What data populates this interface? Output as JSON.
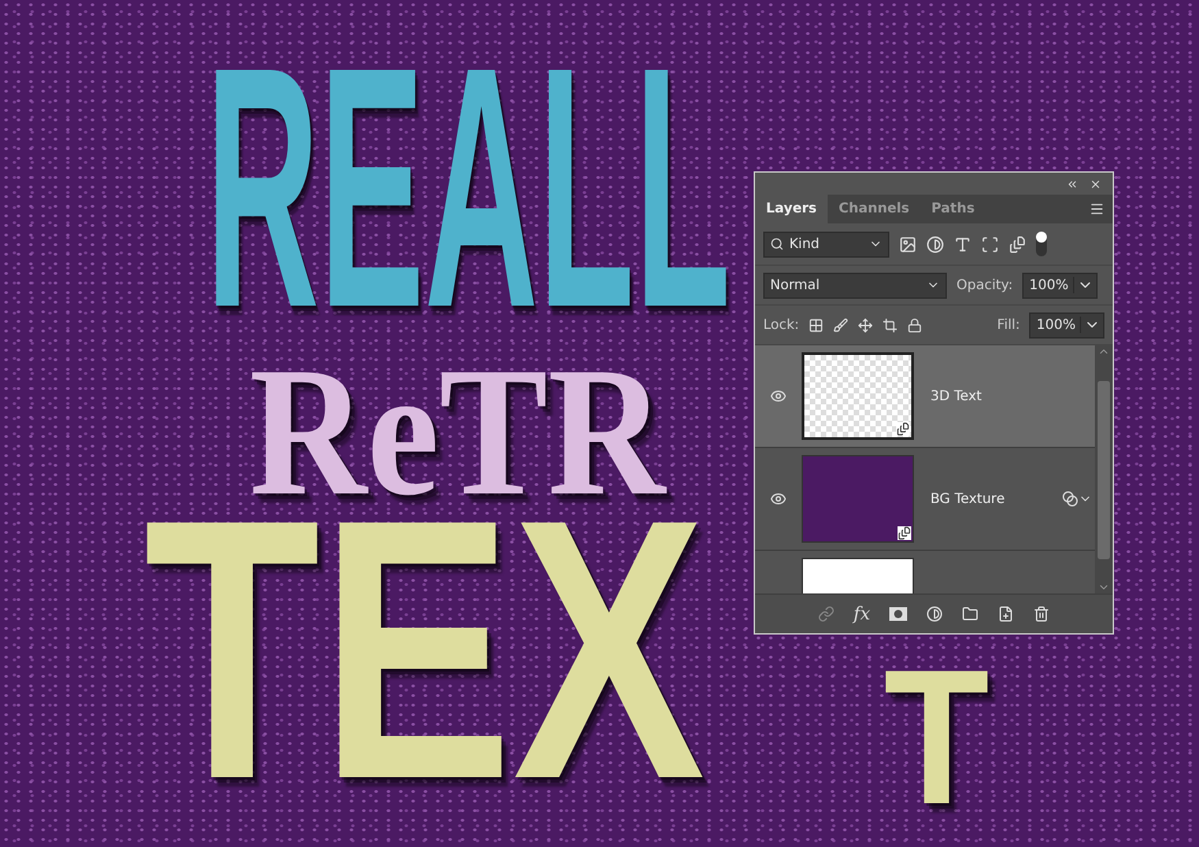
{
  "canvas": {
    "words": [
      {
        "text": "REALL",
        "kind": "sans",
        "color": "#4fb2cc"
      },
      {
        "text": "ReTR",
        "kind": "serif",
        "color": "#dcbde0"
      },
      {
        "text": "TEX",
        "kind": "sans",
        "color": "#dedd9e"
      },
      {
        "text": "T",
        "kind": "sans",
        "color": "#dedd9e"
      }
    ]
  },
  "panel": {
    "tabs": [
      {
        "label": "Layers",
        "selected": true
      },
      {
        "label": "Channels",
        "selected": false
      },
      {
        "label": "Paths",
        "selected": false
      }
    ],
    "filter": {
      "value": "Kind"
    },
    "blend": {
      "value": "Normal"
    },
    "opacity": {
      "label": "Opacity:",
      "value": "100%"
    },
    "lock": {
      "label": "Lock:"
    },
    "fill": {
      "label": "Fill:",
      "value": "100%"
    },
    "layers": [
      {
        "name": "3D Text",
        "visible": true,
        "selected": true,
        "kind": "transparent",
        "smart": true,
        "filters": false
      },
      {
        "name": "BG Texture",
        "visible": true,
        "selected": false,
        "kind": "texture",
        "smart": true,
        "filters": true
      },
      {
        "selected": false,
        "kind": "white"
      }
    ],
    "fx_label": "fx"
  }
}
